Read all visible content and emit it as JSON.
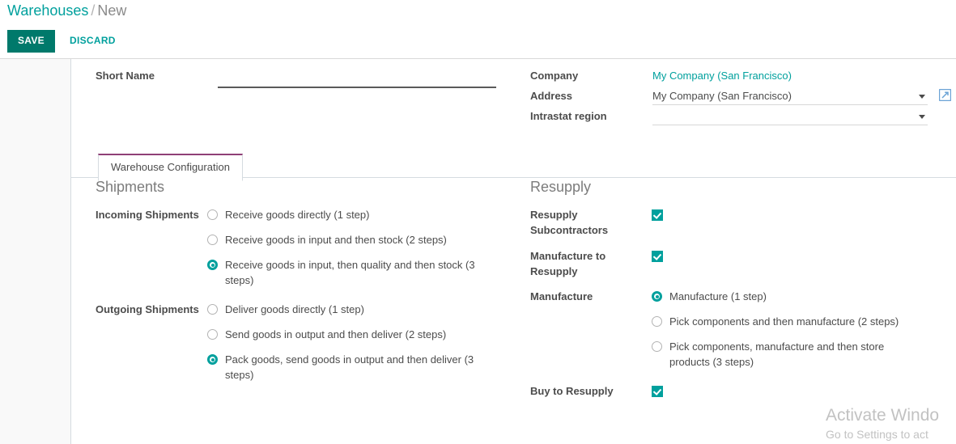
{
  "breadcrumb": {
    "root": "Warehouses",
    "separator": "/",
    "current": "New"
  },
  "toolbar": {
    "save_label": "SAVE",
    "discard_label": "DISCARD"
  },
  "form": {
    "left": {
      "short_name": {
        "label": "Short Name",
        "value": "",
        "placeholder": ""
      }
    },
    "right": {
      "company": {
        "label": "Company",
        "value": "My Company (San Francisco)"
      },
      "address": {
        "label": "Address",
        "value": "My Company (San Francisco)",
        "placeholder": ""
      },
      "intrastat_region": {
        "label": "Intrastat region",
        "value": "",
        "placeholder": ""
      }
    }
  },
  "notebook": {
    "tabs": [
      {
        "label": "Warehouse Configuration",
        "active": true
      }
    ]
  },
  "shipments": {
    "title": "Shipments",
    "incoming": {
      "label": "Incoming Shipments",
      "options": [
        {
          "label": "Receive goods directly (1 step)",
          "checked": false
        },
        {
          "label": "Receive goods in input and then stock (2 steps)",
          "checked": false
        },
        {
          "label": "Receive goods in input, then quality and then stock (3 steps)",
          "checked": true
        }
      ]
    },
    "outgoing": {
      "label": "Outgoing Shipments",
      "options": [
        {
          "label": "Deliver goods directly (1 step)",
          "checked": false
        },
        {
          "label": "Send goods in output and then deliver (2 steps)",
          "checked": false
        },
        {
          "label": "Pack goods, send goods in output and then deliver (3 steps)",
          "checked": true
        }
      ]
    }
  },
  "resupply": {
    "title": "Resupply",
    "resupply_subcontractors": {
      "label": "Resupply Subcontractors",
      "checked": true
    },
    "manufacture_to_resupply": {
      "label": "Manufacture to Resupply",
      "checked": true
    },
    "manufacture": {
      "label": "Manufacture",
      "options": [
        {
          "label": "Manufacture (1 step)",
          "checked": true
        },
        {
          "label": "Pick components and then manufacture (2 steps)",
          "checked": false
        },
        {
          "label": "Pick components, manufacture and then store products (3 steps)",
          "checked": false
        }
      ]
    },
    "buy_to_resupply": {
      "label": "Buy to Resupply",
      "checked": true
    }
  },
  "watermark": {
    "title": "Activate Windo",
    "subtitle": "Go to Settings to act"
  },
  "colors": {
    "accent": "#00A09D",
    "save_button": "#00796B",
    "tab_active_top": "#8f3f76",
    "text": "#4c4c4c"
  }
}
